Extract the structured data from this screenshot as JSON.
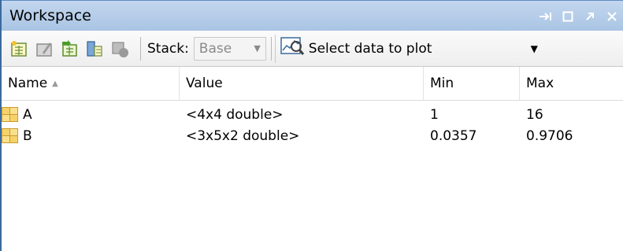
{
  "window": {
    "title": "Workspace",
    "controls": [
      "dock-icon",
      "maximize-icon",
      "undock-icon",
      "close-icon"
    ]
  },
  "toolbar": {
    "icons": [
      "new-variable-icon",
      "open-variable-icon",
      "import-data-icon",
      "save-workspace-icon",
      "delete-variable-icon"
    ],
    "stack_label": "Stack:",
    "stack_value": "Base",
    "plot_label": "Select data to plot"
  },
  "table": {
    "headers": {
      "name": "Name",
      "value": "Value",
      "min": "Min",
      "max": "Max"
    },
    "sort": {
      "column": "name",
      "direction": "ascending"
    },
    "rows": [
      {
        "name": "A",
        "value": "<4x4 double>",
        "min": "1",
        "max": "16"
      },
      {
        "name": "B",
        "value": "<3x5x2 double>",
        "min": "0.0357",
        "max": "0.9706"
      }
    ]
  },
  "colors": {
    "titlebar": "#a9c4e4",
    "border": "#3a6a9e",
    "variable_icon": "#f6d36a"
  }
}
